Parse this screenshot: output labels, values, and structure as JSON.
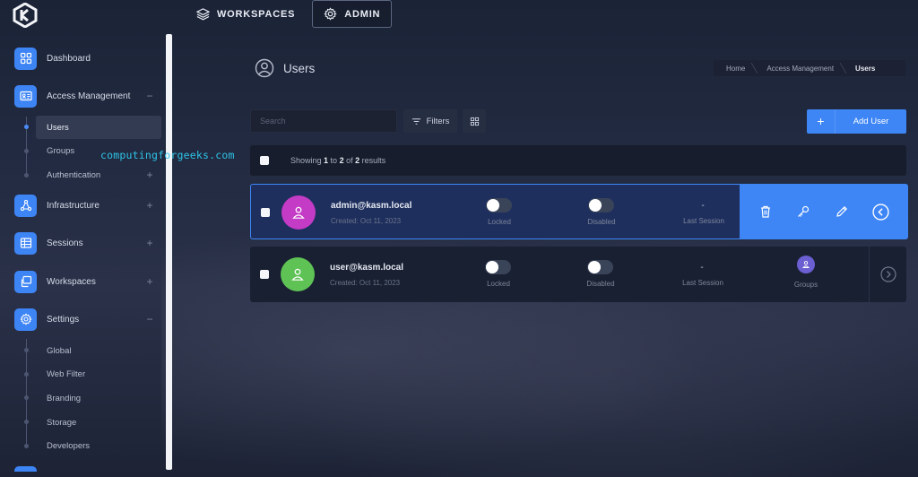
{
  "topnav": {
    "workspaces_label": "WORKSPACES",
    "admin_label": "ADMIN"
  },
  "sidebar": {
    "items": [
      {
        "label": "Dashboard",
        "icon": "dashboard-grid-icon"
      },
      {
        "label": "Access Management",
        "icon": "id-card-icon",
        "toggle": "−"
      },
      {
        "label": "Infrastructure",
        "icon": "network-icon",
        "toggle": "+"
      },
      {
        "label": "Sessions",
        "icon": "table-icon",
        "toggle": "+"
      },
      {
        "label": "Workspaces",
        "icon": "windows-icon",
        "toggle": "+"
      },
      {
        "label": "Settings",
        "icon": "gear-icon",
        "toggle": "−"
      }
    ],
    "access_sub": [
      "Users",
      "Groups",
      "Authentication"
    ],
    "access_sub_toggle": "+",
    "settings_sub": [
      "Global",
      "Web Filter",
      "Branding",
      "Storage",
      "Developers"
    ]
  },
  "watermark": "computingforgeeks.com",
  "page": {
    "title": "Users",
    "breadcrumb": [
      "Home",
      "Access Management",
      "Users"
    ]
  },
  "toolbar": {
    "search_placeholder": "Search",
    "filters_label": "Filters",
    "add_user_label": "Add User"
  },
  "results": {
    "prefix": "Showing ",
    "from": "1",
    "to_word": " to ",
    "to": "2",
    "of_word": " of ",
    "total": "2",
    "suffix": " results"
  },
  "users": [
    {
      "name": "admin@kasm.local",
      "created": "Created: Oct 11, 2023",
      "locked_label": "Locked",
      "disabled_label": "Disabled",
      "last_session_value": "-",
      "last_session_label": "Last Session",
      "avatar_color": "#c43bc6"
    },
    {
      "name": "user@kasm.local",
      "created": "Created: Oct 11, 2023",
      "locked_label": "Locked",
      "disabled_label": "Disabled",
      "last_session_value": "-",
      "last_session_label": "Last Session",
      "groups_label": "Groups",
      "avatar_color": "#5ec255"
    }
  ],
  "colors": {
    "accent": "#3e86f6",
    "background": "#1f2639",
    "groups_badge": "#6c5fd2"
  }
}
